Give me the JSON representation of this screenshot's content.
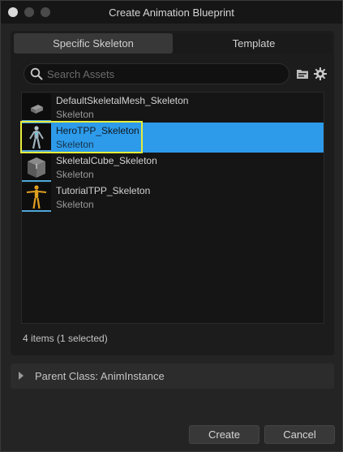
{
  "window": {
    "title": "Create Animation Blueprint"
  },
  "tabs": [
    {
      "label": "Specific Skeleton",
      "active": true
    },
    {
      "label": "Template",
      "active": false
    }
  ],
  "search": {
    "placeholder": "Search Assets",
    "value": ""
  },
  "icons": {
    "search": "search-icon",
    "folder": "folder-icon",
    "settings": "gear-icon"
  },
  "assets": [
    {
      "name": "DefaultSkeletalMesh_Skeleton",
      "type": "Skeleton",
      "thumbnail": "box-mesh-icon",
      "selected": false
    },
    {
      "name": "HeroTPP_Skeleton",
      "type": "Skeleton",
      "thumbnail": "hero-skeleton-icon",
      "selected": true
    },
    {
      "name": "SkeletalCube_Skeleton",
      "type": "Skeleton",
      "thumbnail": "cube-icon",
      "selected": false
    },
    {
      "name": "TutorialTPP_Skeleton",
      "type": "Skeleton",
      "thumbnail": "tutorial-skeleton-icon",
      "selected": false
    }
  ],
  "status": {
    "count_text": "4 items (1 selected)"
  },
  "parent_class": {
    "label": "Parent Class: AnimInstance"
  },
  "buttons": {
    "create": "Create",
    "cancel": "Cancel"
  },
  "colors": {
    "selection": "#2d9bea",
    "highlight_outline": "#e6ec3a",
    "accent_underline": "#4fa7d8"
  }
}
